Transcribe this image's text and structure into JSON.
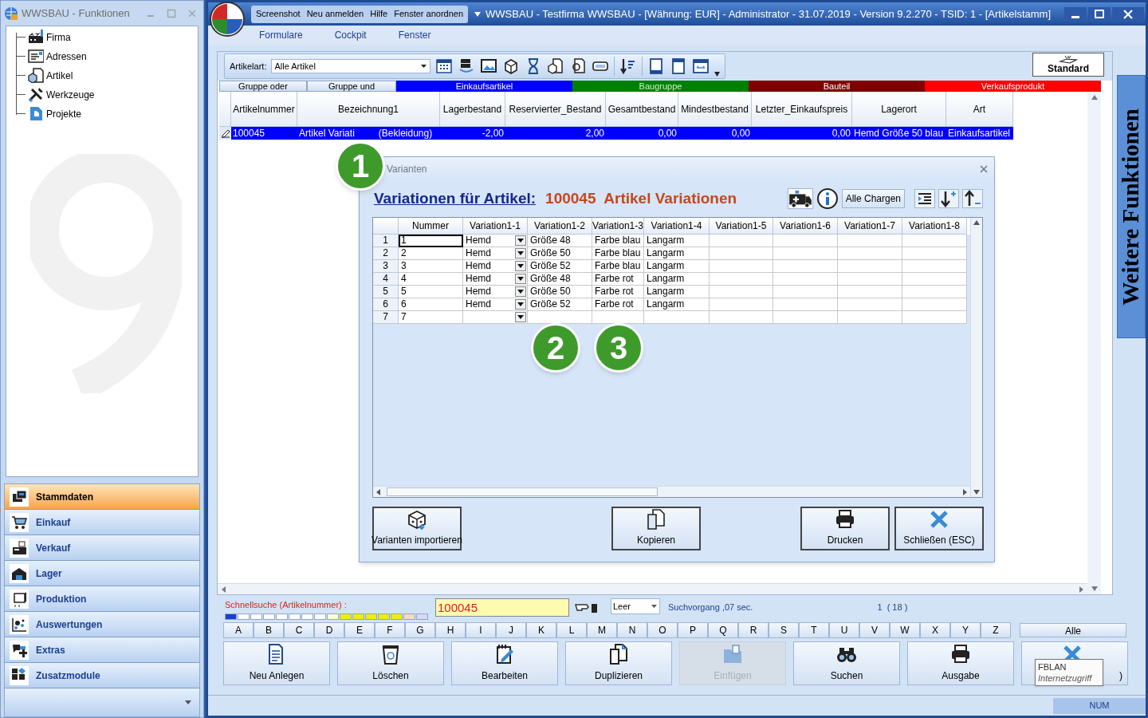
{
  "left_window": {
    "title": "WWSBAU - Funktionen",
    "tree": [
      {
        "label": "Firma"
      },
      {
        "label": "Adressen"
      },
      {
        "label": "Artikel"
      },
      {
        "label": "Werkzeuge"
      },
      {
        "label": "Projekte"
      }
    ],
    "nav": [
      {
        "label": "Stammdaten",
        "selected": true
      },
      {
        "label": "Einkauf",
        "selected": false
      },
      {
        "label": "Verkauf",
        "selected": false
      },
      {
        "label": "Lager",
        "selected": false
      },
      {
        "label": "Produktion",
        "selected": false
      },
      {
        "label": "Auswertungen",
        "selected": false
      },
      {
        "label": "Extras",
        "selected": false
      },
      {
        "label": "Zusatzmodule",
        "selected": false
      }
    ]
  },
  "main_window": {
    "quick_access": [
      "Screenshot",
      "Neu anmelden",
      "Hilfe",
      "Fenster anordnen"
    ],
    "title": "WWSBAU - Testfirma WWSBAU - [Währung: EUR] - Administrator - 31.07.2019 - Version 9.2.270 - TSID: 1  - [Artikelstamm]",
    "menu": [
      "Formulare",
      "Cockpit",
      "Fenster"
    ]
  },
  "toolbar": {
    "filter_label": "Artikelart:",
    "filter_value": "Alle Artikel",
    "standard_button": "Standard"
  },
  "groups": [
    {
      "label": "Gruppe oder",
      "kind": "toggle"
    },
    {
      "label": "Gruppe und",
      "kind": "toggle"
    },
    {
      "label": "Einkaufsartikel",
      "kind": "legend",
      "color": "#0000ff"
    },
    {
      "label": "Baugruppe",
      "kind": "legend",
      "color": "#008000"
    },
    {
      "label": "Bauteil",
      "kind": "legend",
      "color": "#800000"
    },
    {
      "label": "Verkaufsprodukt",
      "kind": "legend",
      "color": "#ff0000"
    }
  ],
  "table": {
    "columns": [
      "Artikelnummer",
      "Bezeichnung1",
      "Lagerbestand",
      "Reservierter_Bestand",
      "Gesamtbestand",
      "Mindestbestand",
      "Letzter_Einkaufspreis",
      "Lagerort",
      "Art"
    ],
    "rows": [
      {
        "selected": true,
        "artikelnummer": "100045",
        "bezeichnung1_visible": [
          "Artikel Variati",
          "(Bekleidung)"
        ],
        "values": [
          "-2,00",
          "2,00",
          "0,00",
          "0,00",
          "0,00"
        ],
        "lagerort": "Hemd Größe 50 blau",
        "art": "Einkaufsartikel"
      }
    ]
  },
  "side_tab": "Weitere Funktionen",
  "dialog": {
    "title": "Varianten",
    "heading": "Variationen für Artikel:",
    "article": "100045  Artikel Variationen",
    "chargen_button": "Alle Chargen",
    "columns": [
      "Nummer",
      "Variation1-1",
      "Variation1-2",
      "Variation1-3",
      "Variation1-4",
      "Variation1-5",
      "Variation1-6",
      "Variation1-7",
      "Variation1-8"
    ],
    "rows": [
      {
        "header": "1",
        "focused": true,
        "cells": [
          "1",
          "Hemd",
          "Größe 48",
          "Farbe blau",
          "Langarm"
        ]
      },
      {
        "header": "2",
        "focused": false,
        "cells": [
          "2",
          "Hemd",
          "Größe 50",
          "Farbe blau",
          "Langarm"
        ]
      },
      {
        "header": "3",
        "focused": false,
        "cells": [
          "3",
          "Hemd",
          "Größe 52",
          "Farbe blau",
          "Langarm"
        ]
      },
      {
        "header": "4",
        "focused": false,
        "cells": [
          "4",
          "Hemd",
          "Größe 48",
          "Farbe rot",
          "Langarm"
        ]
      },
      {
        "header": "5",
        "focused": false,
        "cells": [
          "5",
          "Hemd",
          "Größe 50",
          "Farbe rot",
          "Langarm"
        ]
      },
      {
        "header": "6",
        "focused": false,
        "cells": [
          "6",
          "Hemd",
          "Größe 52",
          "Farbe rot",
          "Langarm"
        ]
      },
      {
        "header": "7",
        "focused": false,
        "cells": [
          "7"
        ]
      }
    ],
    "buttons": [
      {
        "label": "Varianten importieren",
        "kind": "import"
      },
      {
        "label": "Kopieren",
        "kind": "copy"
      },
      {
        "label": "Drucken",
        "kind": "print"
      },
      {
        "label": "Schließen (ESC)",
        "kind": "close"
      }
    ]
  },
  "search": {
    "label": "Schnellsuche (Artikelnummer) :",
    "value": "100045",
    "mode": "Leer",
    "status": "Suchvorgang ,07 sec.",
    "count": "1  ( 18 )"
  },
  "letters": [
    "A",
    "B",
    "C",
    "D",
    "E",
    "F",
    "G",
    "H",
    "I",
    "J",
    "K",
    "L",
    "M",
    "N",
    "O",
    "P",
    "Q",
    "R",
    "S",
    "T",
    "U",
    "V",
    "W",
    "X",
    "Y",
    "Z"
  ],
  "all_button": "Alle",
  "actions": [
    {
      "label": "Neu Anlegen",
      "disabled": false
    },
    {
      "label": "Löschen",
      "disabled": false
    },
    {
      "label": "Bearbeiten",
      "disabled": false
    },
    {
      "label": "Duplizieren",
      "disabled": false
    },
    {
      "label": "Einfügen",
      "disabled": true
    },
    {
      "label": "Suchen",
      "disabled": false
    },
    {
      "label": "Ausgabe",
      "disabled": false
    },
    {
      "label": ")",
      "disabled": false
    }
  ],
  "tooltip": {
    "title": "FBLAN",
    "subtitle": "Internetzugriff"
  },
  "status_bar": {
    "indicator": "NUM"
  },
  "callouts": [
    "1",
    "2",
    "3"
  ]
}
